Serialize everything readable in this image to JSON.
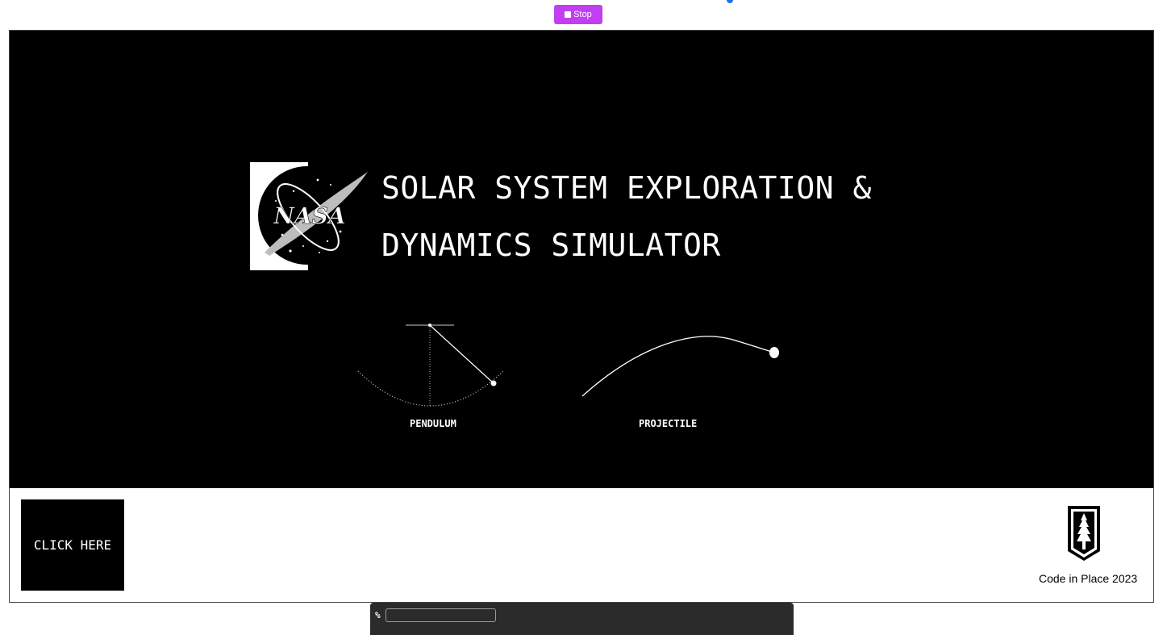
{
  "toolbar": {
    "stop_label": "Stop",
    "stop_icon": "stop-square-icon",
    "accent_color": "#c13ff0",
    "status_color": "#1a73e8"
  },
  "canvas": {
    "background": "#000000",
    "logo_icon": "nasa-meatball-logo",
    "logo_text": "NASA",
    "title_line_1": "SOLAR SYSTEM EXPLORATION &",
    "title_line_2": "DYNAMICS SIMULATOR",
    "pendulum_label": "PENDULUM",
    "projectile_label": "PROJECTILE"
  },
  "footer": {
    "click_here_label": "CLICK HERE",
    "stanford_icon": "stanford-tree-logo",
    "credit": "Code in Place 2023"
  },
  "terminal": {
    "prompt": "%",
    "input_value": ""
  }
}
